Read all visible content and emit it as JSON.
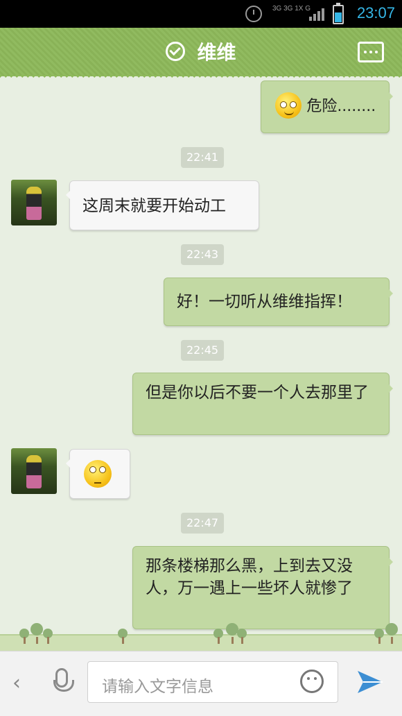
{
  "status_bar": {
    "network_label": "3G 3G 1X G",
    "time": "23:07"
  },
  "header": {
    "title": "维维"
  },
  "messages": [
    {
      "type": "out",
      "text": "危险........"
    },
    {
      "type": "time",
      "text": "22:41"
    },
    {
      "type": "in",
      "text": "这周末就要开始动工"
    },
    {
      "type": "time",
      "text": "22:43"
    },
    {
      "type": "out",
      "text": "好！一切听从维维指挥！"
    },
    {
      "type": "time",
      "text": "22:45"
    },
    {
      "type": "out",
      "text": "但是你以后不要一个人去那里了"
    },
    {
      "type": "in",
      "text": ""
    },
    {
      "type": "time",
      "text": "22:47"
    },
    {
      "type": "out",
      "text": "那条楼梯那么黑，上到去又没人，万一遇上一些坏人就惨了"
    }
  ],
  "input": {
    "placeholder": "请输入文字信息"
  },
  "icons": {
    "back": "chevron-left-icon",
    "mic": "microphone-icon",
    "emoji": "smiley-icon",
    "send": "send-icon",
    "more": "more-icon",
    "verified": "check-circle-icon"
  },
  "colors": {
    "header": "#8db85a",
    "bubble_out": "#c2d9a3",
    "bubble_in": "#f7f7f7",
    "clock": "#35b6e6"
  }
}
